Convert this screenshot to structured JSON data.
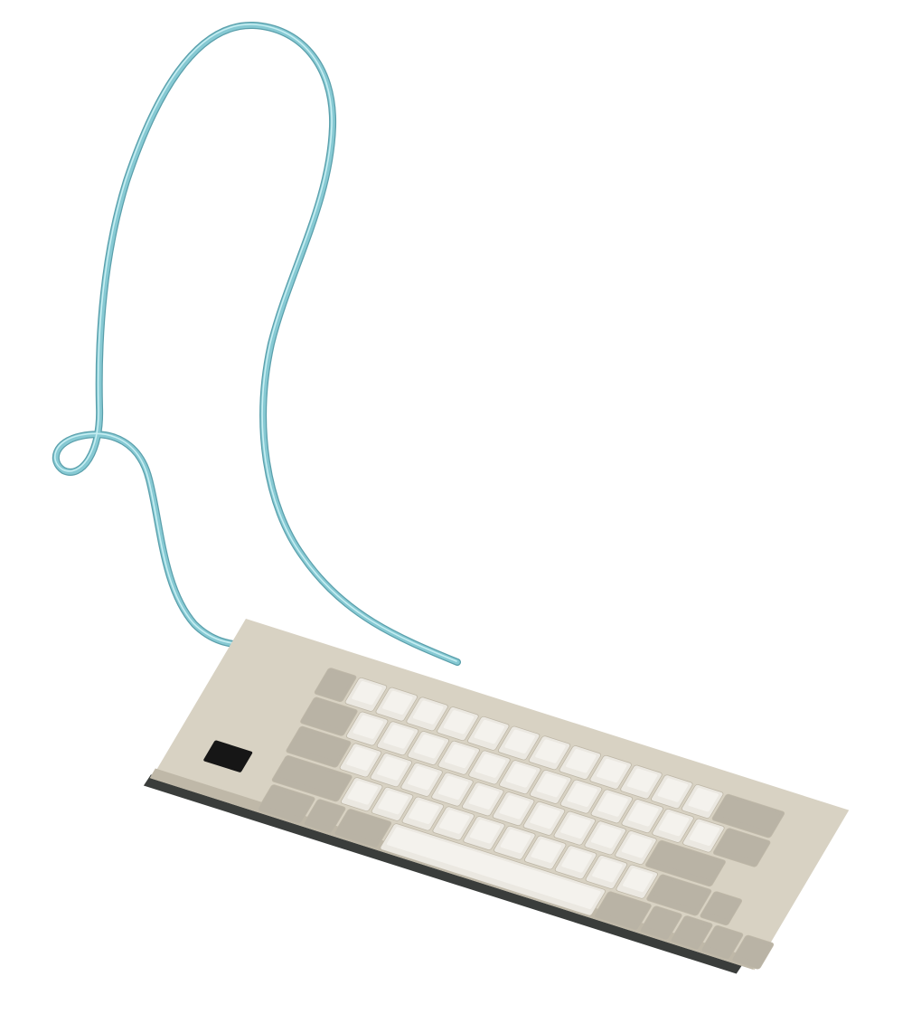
{
  "scene": {
    "subject": "retro-keyboard-with-cable",
    "background_color": "#ffffff",
    "colors": {
      "cable": "#86c9d3",
      "cable_highlight": "#c6eef2",
      "cable_shadow": "#5a9fab",
      "case": "#d8d2c3",
      "case_shade": "#bfb8a8",
      "case_edge": "#3a3d3b",
      "key_light": "#ebe8e1",
      "key_dark": "#b9b3a5",
      "key_top": "#f4f2ed",
      "badge": "#161616"
    },
    "rows": [
      {
        "keys": [
          1,
          1,
          1,
          1,
          1,
          1,
          1,
          1,
          1,
          1,
          1,
          1,
          1,
          2
        ],
        "dark": [
          0,
          13
        ]
      },
      {
        "keys": [
          1.5,
          1,
          1,
          1,
          1,
          1,
          1,
          1,
          1,
          1,
          1,
          1,
          1,
          1.5
        ],
        "dark": [
          0,
          13
        ]
      },
      {
        "keys": [
          1.75,
          1,
          1,
          1,
          1,
          1,
          1,
          1,
          1,
          1,
          1,
          2.25
        ],
        "dark": [
          0,
          11
        ]
      },
      {
        "keys": [
          2.25,
          1,
          1,
          1,
          1,
          1,
          1,
          1,
          1,
          1,
          1,
          1.75,
          1
        ],
        "dark": [
          0,
          11,
          12
        ]
      },
      {
        "keys": [
          1.5,
          1,
          1.5,
          7,
          1.5,
          1,
          1,
          1,
          1
        ],
        "dark": [
          0,
          1,
          2,
          4,
          5,
          6,
          7,
          8
        ]
      }
    ]
  }
}
